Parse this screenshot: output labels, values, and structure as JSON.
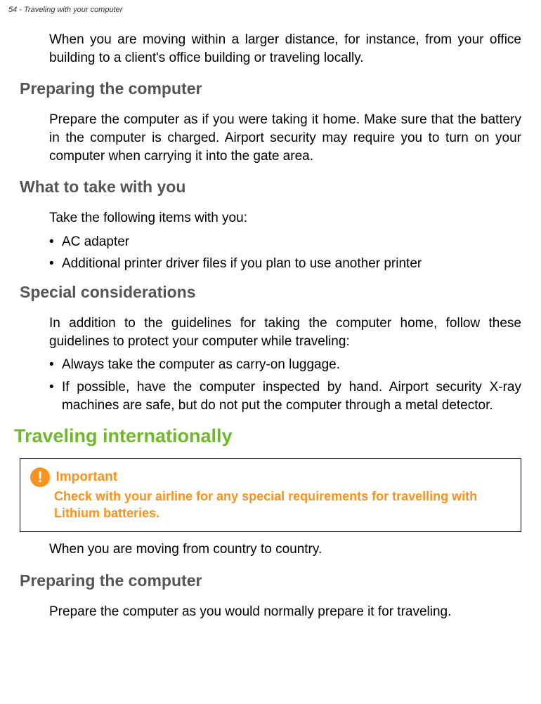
{
  "header": "54 - Traveling with your computer",
  "intro": "When you are moving within a larger distance, for instance, from your office building to a client's office building or traveling locally.",
  "sections": {
    "preparing1": {
      "title": "Preparing the computer",
      "body": "Prepare the computer as if you were taking it home. Make sure that the battery in the computer is charged. Airport security may require you to turn on your computer when carrying it into the gate area."
    },
    "whatToTake": {
      "title": "What to take with you",
      "intro": "Take the following items with you:",
      "items": [
        "AC adapter",
        "Additional printer driver files if you plan to use another printer"
      ]
    },
    "special": {
      "title": "Special considerations",
      "intro": "In addition to the guidelines for taking the computer home, follow these guidelines to protect your computer while traveling:",
      "items": [
        "Always take the computer as carry-on luggage.",
        "If possible, have the computer inspected by hand. Airport security X-ray machines are safe, but do not put the computer through a metal detector."
      ]
    },
    "international": {
      "title": "Traveling internationally",
      "important": {
        "label": "Important",
        "text": "Check with your airline for any special requirements for travelling with Lithium batteries."
      },
      "body": "When you are moving from country to country."
    },
    "preparing2": {
      "title": "Preparing the computer",
      "body": "Prepare the computer as you would normally prepare it for traveling."
    }
  }
}
